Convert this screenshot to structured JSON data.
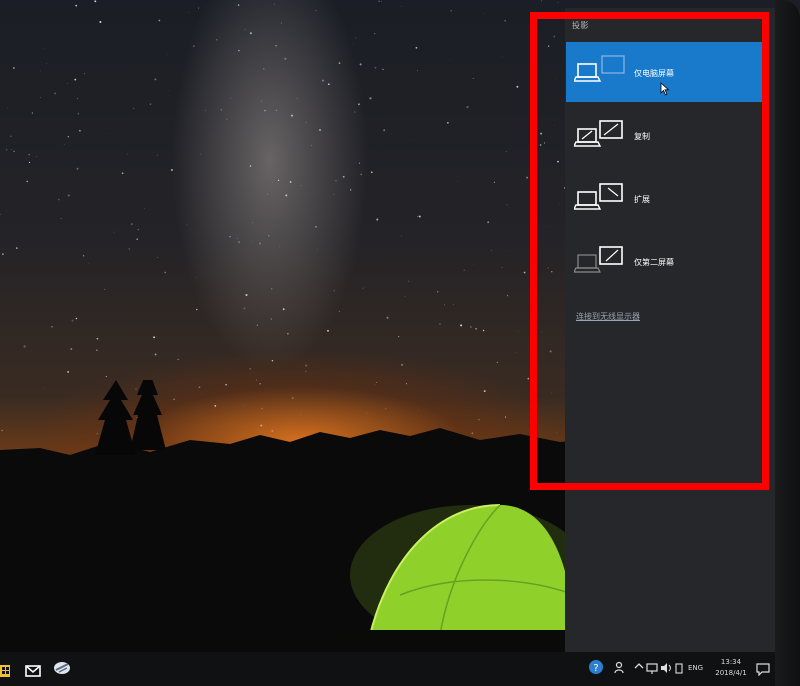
{
  "flyout": {
    "title": "投影",
    "options": [
      {
        "label": "仅电脑屏幕",
        "icon": "pc-screen-only-icon",
        "selected": true
      },
      {
        "label": "复制",
        "icon": "duplicate-icon",
        "selected": false
      },
      {
        "label": "扩展",
        "icon": "extend-icon",
        "selected": false
      },
      {
        "label": "仅第二屏幕",
        "icon": "second-screen-only-icon",
        "selected": false
      }
    ],
    "wireless_link": "连接到无线显示器"
  },
  "taskbar": {
    "pinned": [
      "store-icon",
      "mail-icon",
      "browser-icon"
    ],
    "tray": {
      "language": "ENG",
      "time": "13:34",
      "date": "2018/4/1"
    }
  },
  "colors": {
    "selected": "#1979ca",
    "panel": "#26272a",
    "highlight": "#ff0000"
  }
}
